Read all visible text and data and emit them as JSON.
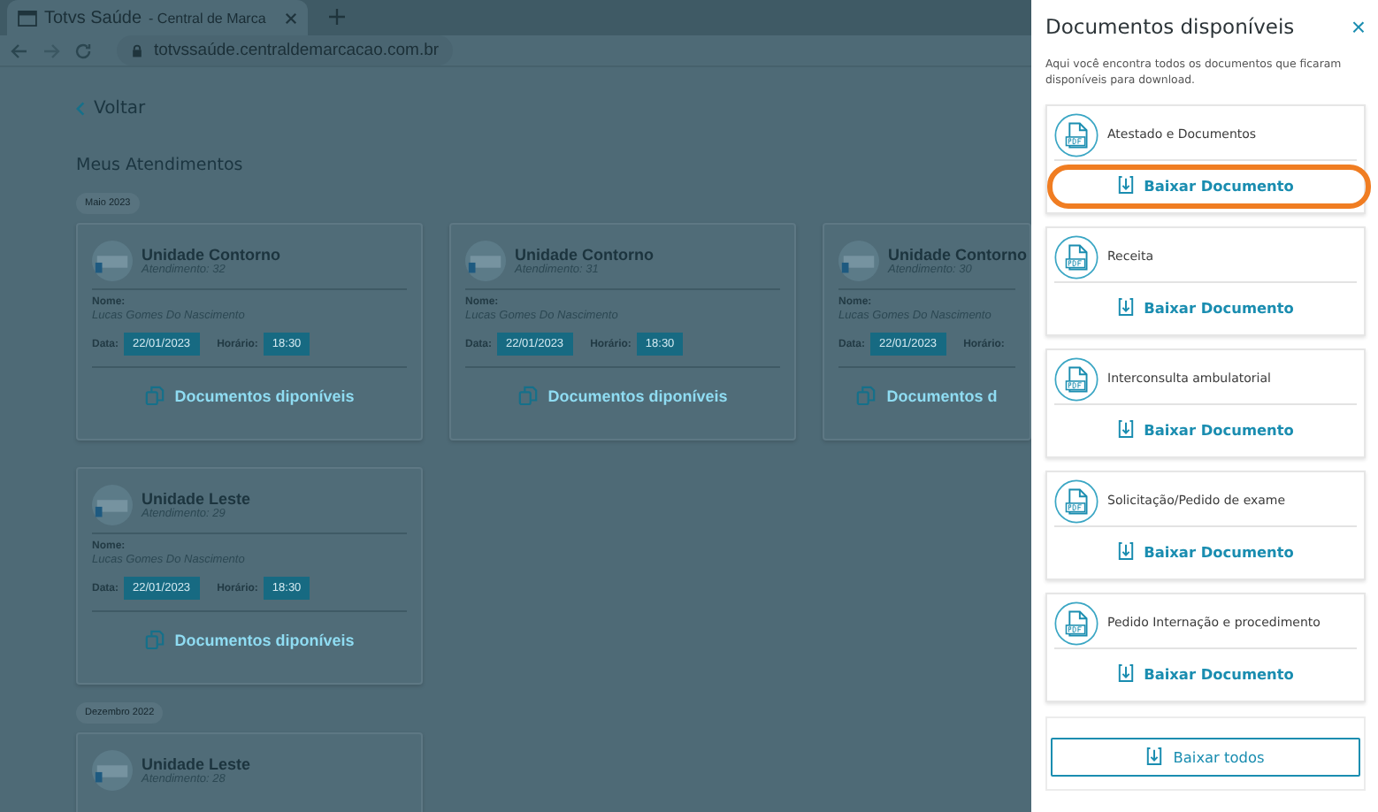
{
  "browser": {
    "tab_title": "Totvs Saúde",
    "tab_subtitle": "- Central de Marca",
    "address": "totvssaúde.centraldemarcacao.com.br"
  },
  "page": {
    "back": "Voltar",
    "title": "Meus Atendimentos",
    "groups": [
      {
        "label": "Maio 2023",
        "appointments": [
          {
            "unit": "Unidade Contorno",
            "number": "Atendimento: 32",
            "name_label": "Nome:",
            "name": "Lucas Gomes Do Nascimento",
            "date_label": "Data:",
            "date": "22/01/2023",
            "time_label": "Horário:",
            "time": "18:30",
            "docs_link": "Documentos diponíveis"
          },
          {
            "unit": "Unidade Contorno",
            "number": "Atendimento: 31",
            "name_label": "Nome:",
            "name": "Lucas Gomes Do Nascimento",
            "date_label": "Data:",
            "date": "22/01/2023",
            "time_label": "Horário:",
            "time": "18:30",
            "docs_link": "Documentos diponíveis"
          },
          {
            "unit": "Unidade Contorno",
            "number": "Atendimento: 30",
            "name_label": "Nome:",
            "name": "Lucas Gomes Do Nascimento",
            "date_label": "Data:",
            "date": "22/01/2023",
            "time_label": "Horário:",
            "docs_link": "Documentos d"
          },
          {
            "unit": "Unidade Leste",
            "number": "Atendimento: 29",
            "name_label": "Nome:",
            "name": "Lucas Gomes Do Nascimento",
            "date_label": "Data:",
            "date": "22/01/2023",
            "time_label": "Horário:",
            "time": "18:30",
            "docs_link": "Documentos diponíveis"
          }
        ]
      },
      {
        "label": "Dezembro 2022",
        "appointments": [
          {
            "unit": "Unidade Leste",
            "number": "Atendimento: 28"
          }
        ]
      }
    ]
  },
  "drawer": {
    "title": "Documentos disponíveis",
    "close": "×",
    "description": "Aqui você encontra todos os documentos que ficaram disponíveis para download.",
    "documents": [
      {
        "name": "Atestado e Documentos",
        "action": "Baixar Documento",
        "highlighted": true
      },
      {
        "name": "Receita",
        "action": "Baixar Documento",
        "highlighted": false
      },
      {
        "name": "Interconsulta ambulatorial",
        "action": "Baixar Documento",
        "highlighted": false
      },
      {
        "name": "Solicitação/Pedido de exame",
        "action": "Baixar Documento",
        "highlighted": false
      },
      {
        "name": "Pedido Internação e procedimento",
        "action": "Baixar Documento",
        "highlighted": false
      }
    ],
    "download_all": "Baixar todos"
  }
}
